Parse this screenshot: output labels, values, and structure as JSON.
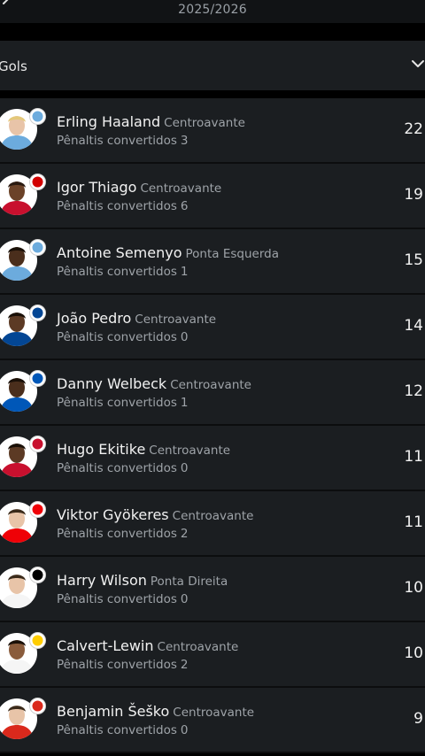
{
  "header": {
    "season": "2025/2026"
  },
  "dropdown": {
    "label": "Gols"
  },
  "players": [
    {
      "name": "Erling Haaland",
      "position": "Centroavante",
      "penalties_label": "Pênaltis convertidos",
      "penalties": "3",
      "goals": "22",
      "club_color": "#6CABDD",
      "skin": "#e8c4a8",
      "hair": "#e4c87a",
      "shirt": "#6CABDD"
    },
    {
      "name": "Igor Thiago",
      "position": "Centroavante",
      "penalties_label": "Pênaltis convertidos",
      "penalties": "6",
      "goals": "19",
      "club_color": "#d20000",
      "skin": "#6b4228",
      "hair": "#2a1a10",
      "shirt": "#c8102e"
    },
    {
      "name": "Antoine Semenyo",
      "position": "Ponta Esquerda",
      "penalties_label": "Pênaltis convertidos",
      "penalties": "1",
      "goals": "15",
      "club_color": "#6CABDD",
      "skin": "#4a2e1c",
      "hair": "#1a1008",
      "shirt": "#6CABDD"
    },
    {
      "name": "João Pedro",
      "position": "Centroavante",
      "penalties_label": "Pênaltis convertidos",
      "penalties": "0",
      "goals": "14",
      "club_color": "#034694",
      "skin": "#5c3a24",
      "hair": "#1a1008",
      "shirt": "#034694"
    },
    {
      "name": "Danny Welbeck",
      "position": "Centroavante",
      "penalties_label": "Pênaltis convertidos",
      "penalties": "1",
      "goals": "12",
      "club_color": "#0057B8",
      "skin": "#4a2e1c",
      "hair": "#1a1008",
      "shirt": "#0057B8"
    },
    {
      "name": "Hugo Ekitike",
      "position": "Centroavante",
      "penalties_label": "Pênaltis convertidos",
      "penalties": "0",
      "goals": "11",
      "club_color": "#C8102E",
      "skin": "#5c3a24",
      "hair": "#1a1008",
      "shirt": "#C8102E"
    },
    {
      "name": "Viktor Gyökeres",
      "position": "Centroavante",
      "penalties_label": "Pênaltis convertidos",
      "penalties": "2",
      "goals": "11",
      "club_color": "#EF0107",
      "skin": "#e8c4a8",
      "hair": "#3a2a1a",
      "shirt": "#EF0107"
    },
    {
      "name": "Harry Wilson",
      "position": "Ponta Direita",
      "penalties_label": "Pênaltis convertidos",
      "penalties": "0",
      "goals": "10",
      "club_color": "#000000",
      "skin": "#e8c4a8",
      "hair": "#3a2a1a",
      "shirt": "#f5f5f5"
    },
    {
      "name": "Calvert-Lewin",
      "position": "Centroavante",
      "penalties_label": "Pênaltis convertidos",
      "penalties": "2",
      "goals": "10",
      "club_color": "#FFCD00",
      "skin": "#8a5c3c",
      "hair": "#1a1008",
      "shirt": "#f5f5f5"
    },
    {
      "name": "Benjamin Šeško",
      "position": "Centroavante",
      "penalties_label": "Pênaltis convertidos",
      "penalties": "0",
      "goals": "9",
      "club_color": "#DA291C",
      "skin": "#e8c4a8",
      "hair": "#3a2a1a",
      "shirt": "#DA291C"
    }
  ]
}
